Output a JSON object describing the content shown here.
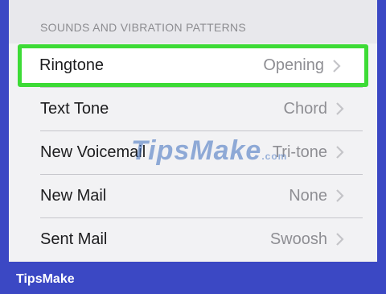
{
  "section": {
    "header": "SOUNDS AND VIBRATION PATTERNS"
  },
  "rows": [
    {
      "label": "Ringtone",
      "value": "Opening"
    },
    {
      "label": "Text Tone",
      "value": "Chord"
    },
    {
      "label": "New Voicemail",
      "value": "Tri-tone"
    },
    {
      "label": "New Mail",
      "value": "None"
    },
    {
      "label": "Sent Mail",
      "value": "Swoosh"
    }
  ],
  "watermark": {
    "text": "TipsMake",
    "suffix": ".com"
  },
  "brand": {
    "text": "TipsMake"
  },
  "colors": {
    "highlight": "#3ddb36",
    "border": "#3b48c4"
  },
  "icons": {
    "chevron": "chevron-right-icon"
  }
}
